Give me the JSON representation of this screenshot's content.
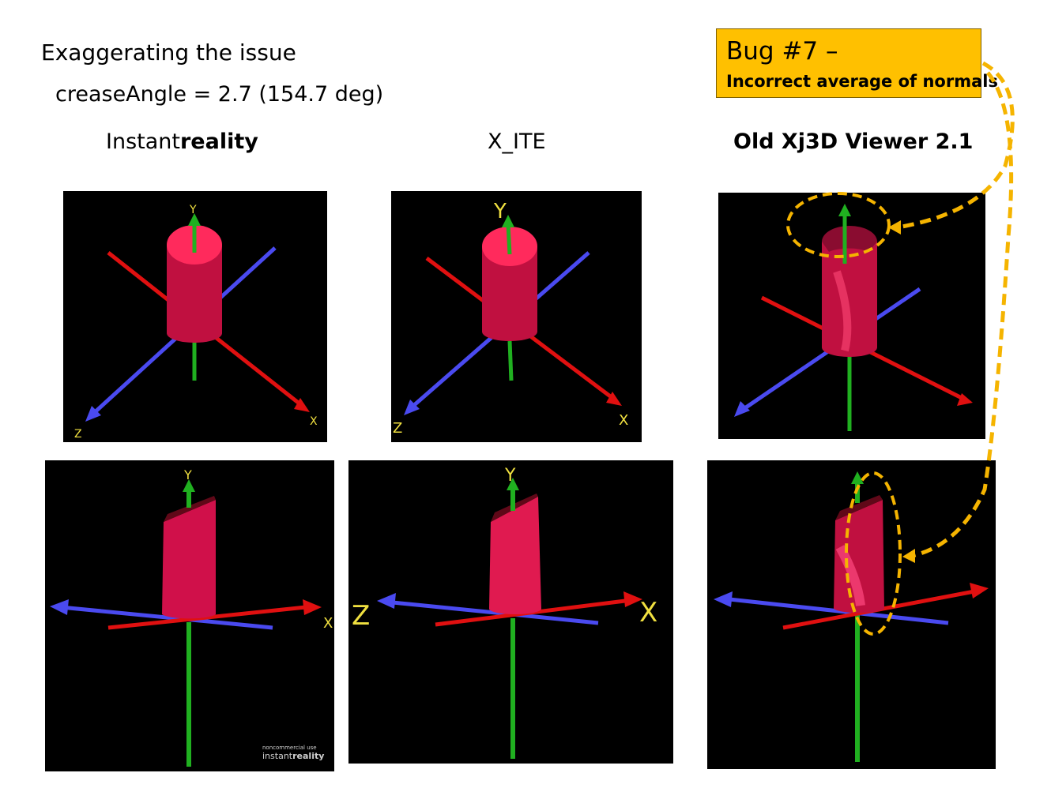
{
  "heading": "Exaggerating the issue",
  "subheading": "creaseAngle = 2.7 (154.7 deg)",
  "columns": {
    "instant_prefix": "Instant",
    "instant_suffix": "reality",
    "xite": "X_ITE",
    "xj3d": "Old Xj3D Viewer 2.1"
  },
  "bug": {
    "title": "Bug #7 –",
    "subtitle": "Incorrect average of normals",
    "fill_color": "#ffc000",
    "callout_color": "#f5b400"
  },
  "axis_labels": {
    "x": "X",
    "y": "Y",
    "z": "Z"
  },
  "watermark": {
    "small": "noncommercial use",
    "prefix": "instant",
    "suffix": "reality"
  },
  "colors": {
    "x_axis": "#e01010",
    "y_axis": "#20b020",
    "z_axis": "#4a4af0",
    "cylinder": "#e0154a",
    "label": "#f0e040",
    "background": "#000000"
  }
}
